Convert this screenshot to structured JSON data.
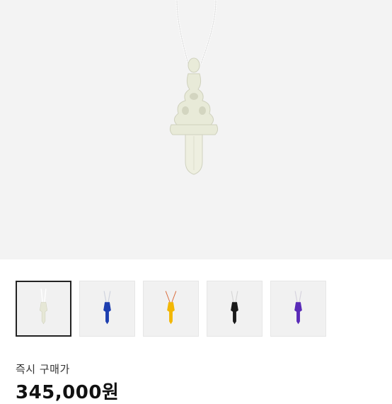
{
  "product": {
    "image_icon": "dagger-pendant-necklace-icon",
    "variants": [
      {
        "name": "white-dagger-pendant-icon",
        "color": "#e6e7d6"
      },
      {
        "name": "blue-dagger-pendant-icon",
        "color": "#1e3fb0"
      },
      {
        "name": "yellow-dagger-pendant-icon",
        "color": "#f2b705"
      },
      {
        "name": "black-dagger-pendant-icon",
        "color": "#1a1a1a"
      },
      {
        "name": "purple-dagger-pendant-icon",
        "color": "#5a2bb8"
      }
    ],
    "selected_variant_index": 0
  },
  "purchase": {
    "label": "즉시 구매가",
    "price": "345,000원"
  }
}
